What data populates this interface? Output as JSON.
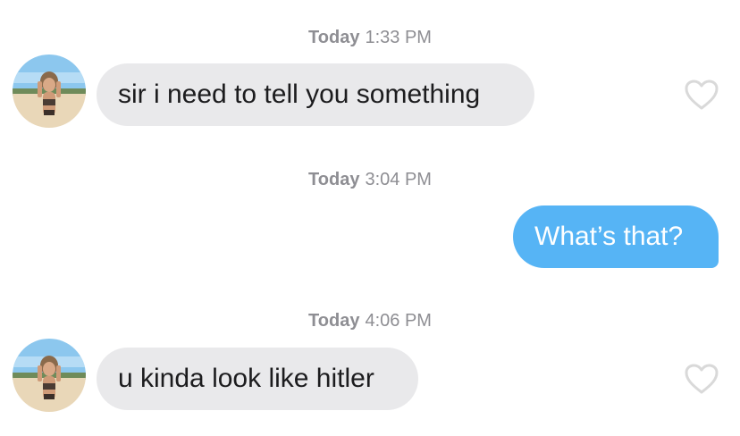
{
  "messages": [
    {
      "timestamp_day": "Today",
      "timestamp_time": "1:33 PM",
      "direction": "incoming",
      "text": "sir i need to tell you something",
      "avatar": "profile-photo",
      "like_icon": "heart-outline-icon"
    },
    {
      "timestamp_day": "Today",
      "timestamp_time": "3:04 PM",
      "direction": "outgoing",
      "text": "What’s that?"
    },
    {
      "timestamp_day": "Today",
      "timestamp_time": "4:06 PM",
      "direction": "incoming",
      "text": "u kinda look like hitler",
      "avatar": "profile-photo",
      "like_icon": "heart-outline-icon"
    }
  ],
  "colors": {
    "incoming_bubble": "#e9e9eb",
    "outgoing_bubble": "#56b4f5",
    "timestamp": "#8e8e93",
    "heart_outline": "#d9d9d9"
  }
}
